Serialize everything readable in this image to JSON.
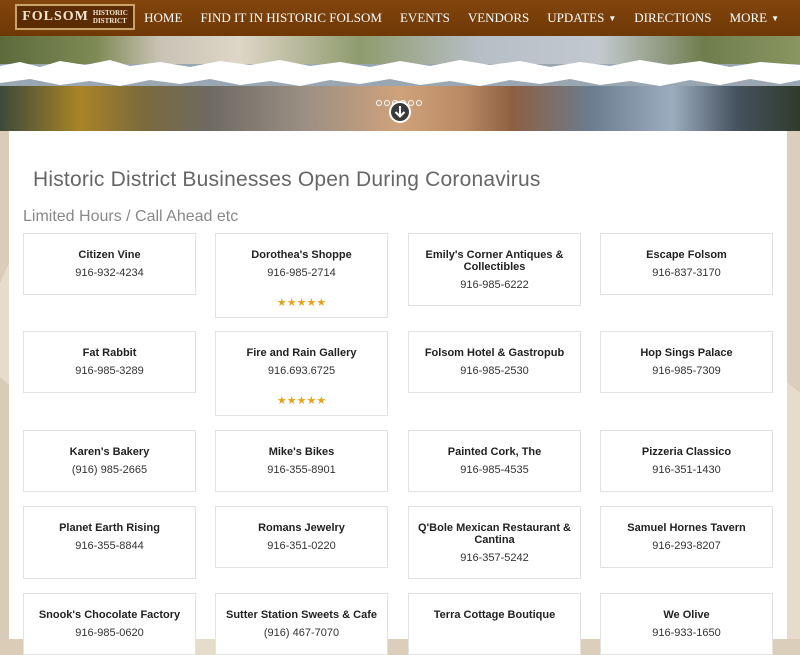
{
  "nav": {
    "logo_main": "FOLSOM",
    "logo_sub_1": "HISTORIC",
    "logo_sub_2": "DISTRICT",
    "items": [
      {
        "label": "HOME"
      },
      {
        "label": "FIND IT IN HISTORIC FOLSOM"
      },
      {
        "label": "EVENTS"
      },
      {
        "label": "VENDORS"
      },
      {
        "label": "UPDATES"
      },
      {
        "label": "DIRECTIONS"
      },
      {
        "label": "MORE"
      }
    ]
  },
  "page": {
    "title": "Historic District Businesses Open During Coronavirus",
    "section": "Limited Hours / Call Ahead etc"
  },
  "businesses": [
    {
      "name": "Citizen Vine",
      "phone": "916-932-4234"
    },
    {
      "name": "Dorothea's Shoppe",
      "phone": "916-985-2714",
      "rating": 5
    },
    {
      "name": "Emily's Corner Antiques & Collectibles",
      "phone": "916-985-6222"
    },
    {
      "name": "Escape Folsom",
      "phone": "916-837-3170"
    },
    {
      "name": "Fat Rabbit",
      "phone": "916-985-3289"
    },
    {
      "name": "Fire and Rain Gallery",
      "phone": "916.693.6725",
      "rating": 5
    },
    {
      "name": "Folsom Hotel & Gastropub",
      "phone": "916-985-2530"
    },
    {
      "name": "Hop Sings Palace",
      "phone": "916-985-7309"
    },
    {
      "name": "Karen's Bakery",
      "phone": "(916) 985-2665"
    },
    {
      "name": "Mike's Bikes",
      "phone": "916-355-8901"
    },
    {
      "name": "Painted Cork, The",
      "phone": "916-985-4535"
    },
    {
      "name": "Pizzeria Classico",
      "phone": "916-351-1430"
    },
    {
      "name": "Planet Earth Rising",
      "phone": "916-355-8844"
    },
    {
      "name": "Romans Jewelry",
      "phone": "916-351-0220"
    },
    {
      "name": "Q'Bole Mexican Restaurant & Cantina",
      "phone": "916-357-5242"
    },
    {
      "name": "Samuel Hornes Tavern",
      "phone": "916-293-8207"
    },
    {
      "name": "Snook's Chocolate Factory",
      "phone": "916-985-0620"
    },
    {
      "name": "Sutter Station Sweets & Cafe",
      "phone": "(916) 467-7070"
    },
    {
      "name": "Terra Cottage Boutique",
      "phone": ""
    },
    {
      "name": "We Olive",
      "phone": "916-933-1650"
    }
  ],
  "colors": {
    "nav_bg": "#7a3f0a",
    "star": "#e0a51b"
  },
  "icons": {
    "scroll_down": "arrow-down-circle-icon",
    "dropdown": "caret-down-icon",
    "rating": "star-icon"
  }
}
